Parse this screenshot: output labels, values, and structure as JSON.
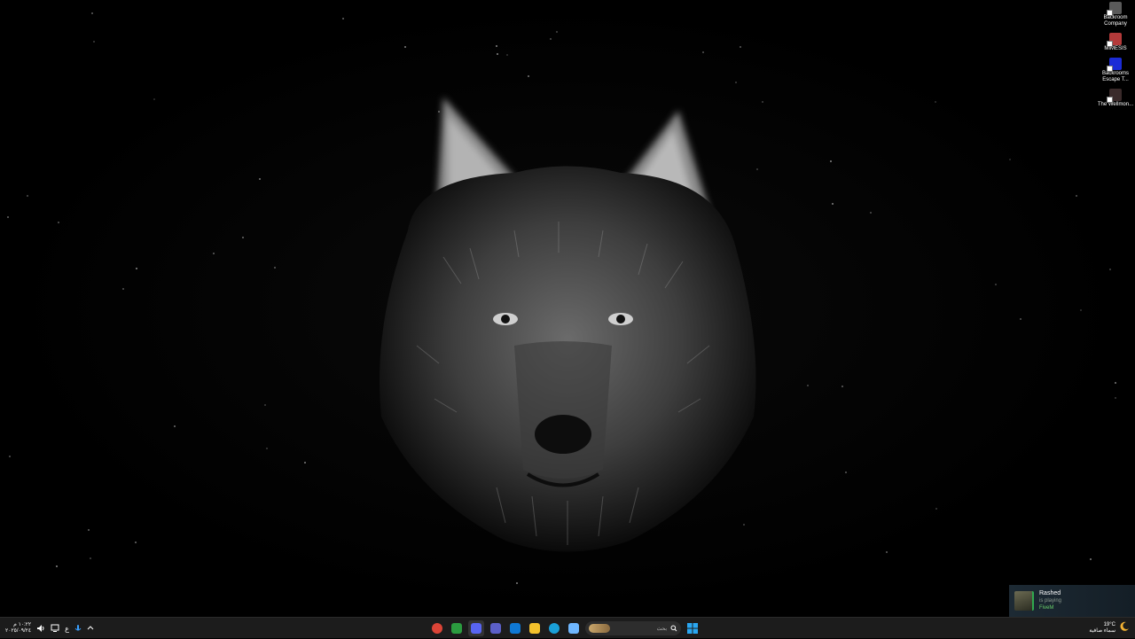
{
  "desktop": {
    "icons": [
      {
        "label": "Backroom Company",
        "icon": "game-icon",
        "color": "#5a5a5a"
      },
      {
        "label": "MIMESIS",
        "icon": "game-icon",
        "color": "#b33a3a"
      },
      {
        "label": "Backrooms Escape T...",
        "icon": "game-icon",
        "color": "#1b2bd6"
      },
      {
        "label": "The Wellmon...",
        "icon": "game-icon",
        "color": "#3a2a2a"
      }
    ]
  },
  "notification": {
    "name": "Rashed",
    "status": "is playing",
    "game": "FiveM"
  },
  "taskbar": {
    "clock_time": "١٠:٢٢ م",
    "clock_date": "٢٠٢٥/٠٩/٢٤",
    "language": "ع",
    "search_placeholder": "بحث",
    "weather_temp": "19°C",
    "weather_desc": "سماء صافية",
    "apps": [
      {
        "name": "chrome-icon",
        "color": "#db4437"
      },
      {
        "name": "xbox-icon",
        "color": "#2b9b3f"
      },
      {
        "name": "discord-icon",
        "color": "#5865f2"
      },
      {
        "name": "teams-icon",
        "color": "#5b5fc7"
      },
      {
        "name": "outlook-icon",
        "color": "#0f78d4"
      },
      {
        "name": "file-explorer-icon",
        "color": "#f3c12c"
      },
      {
        "name": "edge-icon",
        "color": "#1aa0d8"
      },
      {
        "name": "copilot-icon",
        "color": "#6fb7ff"
      }
    ],
    "start_color": "#2aa7f2"
  }
}
